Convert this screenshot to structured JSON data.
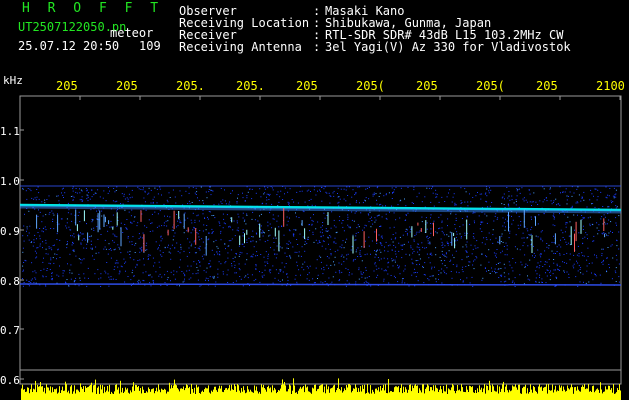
{
  "header": {
    "title": "H R O F F T",
    "filename": "UT2507122050.pn",
    "type": "meteor",
    "datetime": "25.07.12 20:50",
    "count": "109"
  },
  "info": [
    {
      "key": "Observer",
      "value": "Masaki Kano"
    },
    {
      "key": "Receiving Location",
      "value": "Shibukawa, Gunma, Japan"
    },
    {
      "key": "Receiver",
      "value": "RTL-SDR SDR# 43dB L15 103.2MHz CW"
    },
    {
      "key": "Receiving Antenna",
      "value": "3el Yagi(V) Az 330 for Vladivostok"
    }
  ],
  "axis": {
    "y_unit": "kHz",
    "y_labels": [
      "1.1",
      "1.0",
      "0.9",
      "0.8",
      "0.7",
      "0.6"
    ],
    "x_labels": [
      "205",
      "205",
      "205.",
      "205.",
      "205",
      "205(",
      "205",
      "205(",
      "205",
      "2100"
    ]
  },
  "colors": {
    "background": "#000000",
    "grid": "#7f7f7f",
    "signal": "#00ffff",
    "noise": "#1a3cff",
    "bars": "#ffff00",
    "title": "#22e622"
  }
}
